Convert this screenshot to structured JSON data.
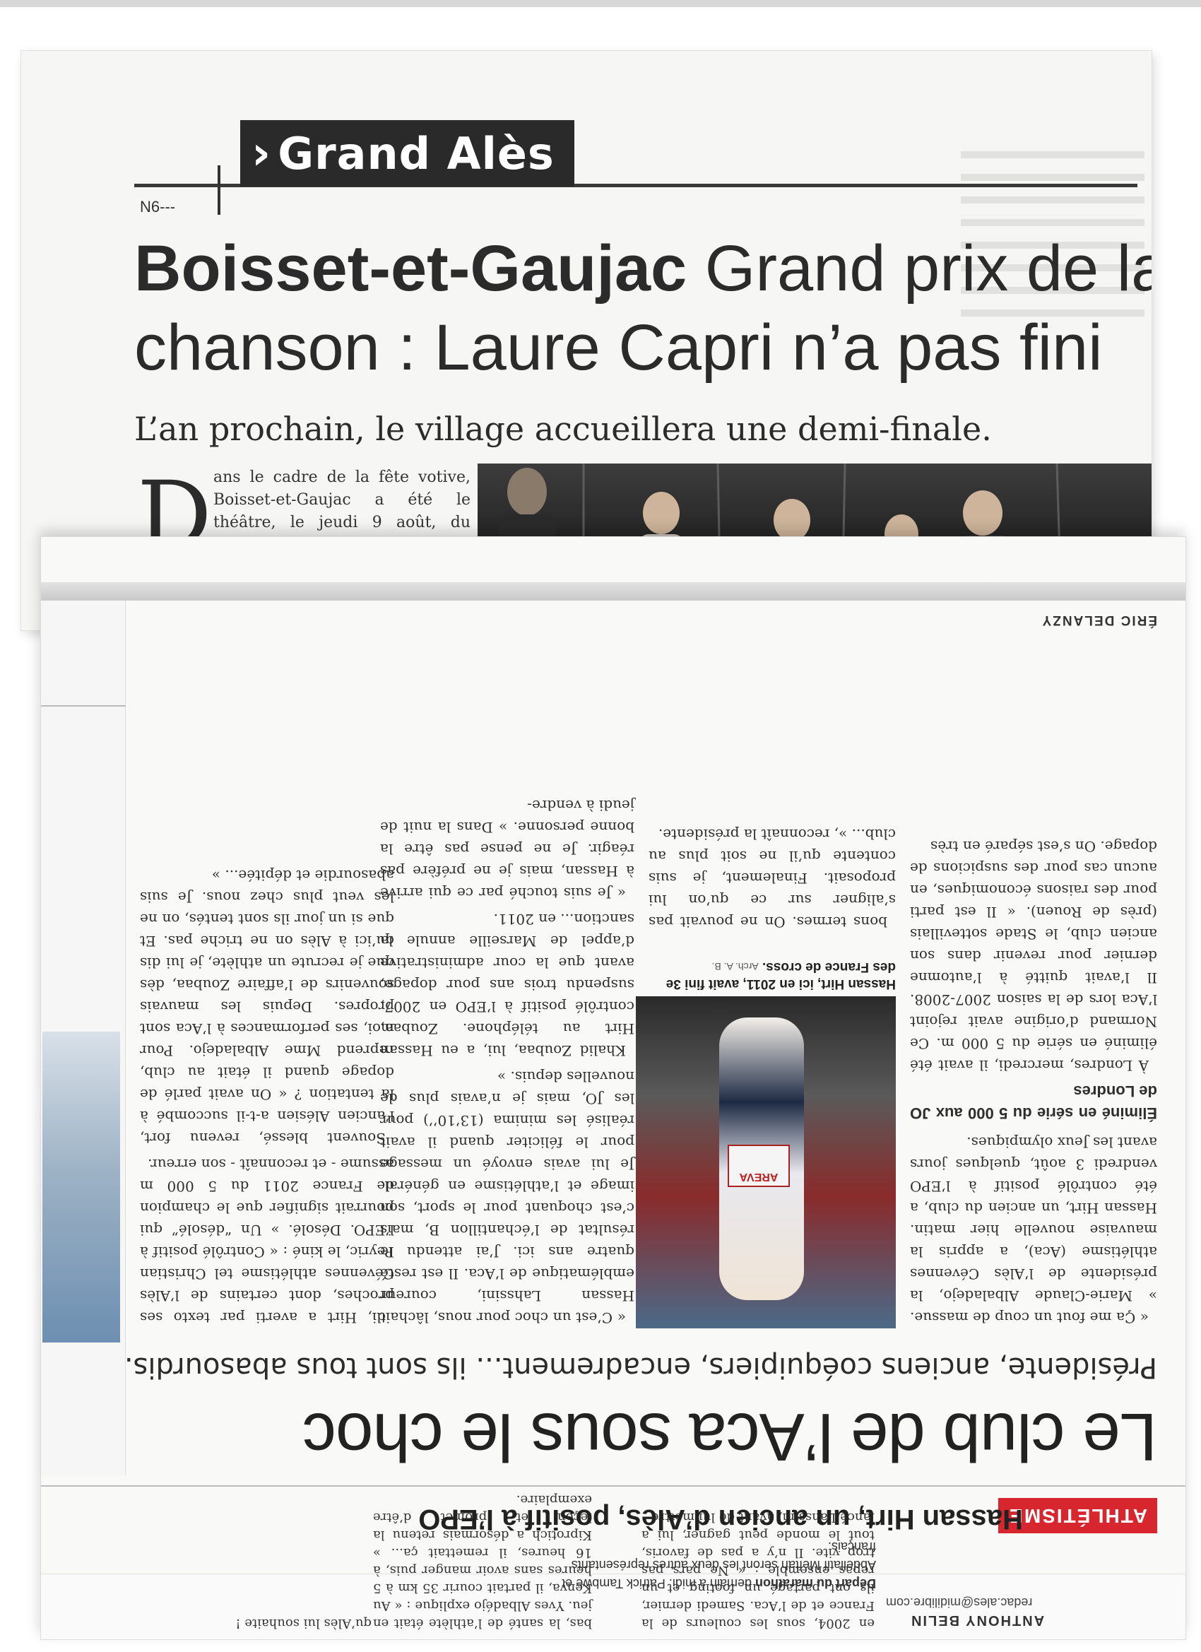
{
  "upper_clipping": {
    "rubric_chevron": "›",
    "rubric": "Grand Alès",
    "page_code": "N6---",
    "headline_place": "Boisset-et-Gaujac",
    "headline_rest": " Grand prix de la",
    "headline_line2": "chanson : Laure Capri n’a pas fini",
    "subhead": "L’an prochain, le village accueillera une demi-finale.",
    "dropcap": "D",
    "intro": "ans le cadre de la fête votive, Boisset-et-Gaujac a été le théâtre, le jeudi 9 août, du quart de finale du grand prix de la chan-"
  },
  "lower_clipping": {
    "byline_top": "ANTHONY BELIN",
    "email": "redac.ales@midilibre.com",
    "brief_title": "Départ du marathon",
    "brief_text": " demain à midi. Patrick Tambwe et Abdellatif Meftah seront les deux autres représentants français.",
    "mini_col_a": "bas, la santé de l’athlète était en jeu. Yves Albadéjo explique : « Au Kenya, il partait courir 35 km à 5 heures sans avoir manger puis, à 16 heures, il remettait ça... » Kiprotich a désormais retenu la leçon et promet d’être exemplaire.",
    "mini_col_b": "en 2004, sous les couleurs de la France et de l’Aca. Samedi dernier, ils ont partagé un footing et un repas ensemble : « Ne pars pas trop vite. Il n’y a pas de favoris, tout le monde peut gagner, lui a lancé Lahssini, avant de lui mettre",
    "mini_col_c": "qu’Alès lui souhaite !",
    "tag": "ATHLÉTISME",
    "kicker": "Hassan Hirt, un ancien d’Alès, positif à l’EPO",
    "headline": "Le club de l’Aca sous le choc",
    "deck": "Présidente, anciens coéquipiers, encadrement... ils sont tous abasourdis.",
    "col1": [
      "« Ça me fout un coup de massue. » Marie-Claude Albaladejo, la présidente de l’Alès Cévennes athlétisme (Aca), a appris la mauvaise nouvelle hier matin. Hassan Hirt, un ancien du club, a été contrôlé positif à l’EPO vendredi 3 août, quelques jours avant les Jeux olympiques."
    ],
    "col1_sub": "Éliminé en série du 5 000 aux JO de Londres",
    "col1_b": "À Londres, mercredi, il avait été éliminé en série du 5 000 m. Ce Normand d’origine avait rejoint l’Aca lors de la saison 2007-2008. Il l’avait quitté à l’automne dernier pour revenir dans son ancien club, le Stade sottevillais (près de Rouen). « Il est parti pour des raisons économiques, en aucun cas pour des suspicions de dopage. On s’est séparé en très",
    "col2": "bons termes. On ne pouvait pas s’aligner sur ce qu’on lui proposait. Finalement, je suis contente qu’il ne soit plus au club... », reconnaît la présidente.",
    "col3": [
      "« C’est un choc pour nous, lâchait Hassan Lahssini, coureur emblématique de l’Aca. Il est resté quatre ans ici. J’ai attendu le résultat de l’échantillon B, mais c’est choquant pour le sport, son image et l’athlétisme en général. Je lui avais envoyé un message pour le féliciter quand il avait réalisé les minima (13’10’’) pour les JO, mais je n’avais plus de nouvelles depuis. »",
      "Khalid Zoubaa, lui, a eu Hassan Hirt au téléphone. Zoubaa, contrôlé positif à l’EPO en 2007, suspendu trois ans pour dopage, avant que la cour administrative d’appel de Marseille annule la sanction... en 2011.",
      "« Je suis touché par ce qui arrive à Hassan, mais je ne préfère pas réagir. Je ne pense pas être la bonne personne. » Dans la nuit de jeudi à vendre-"
    ],
    "col4": [
      "di, Hirt a averti par texto ses proches, dont certains de l’Alès Cévennes athlétisme tel Christian Peyric, le kiné : « Contrôlé positif à l’EPO. Désolé. » Un “désolé” qui pourrait signifier que le champion de France 2011 du 5 000 m assume - et reconnaît - son erreur.",
      "Souvent blessé, revenu fort, l’ancien Alésien a-t-il succombé à la tentation ? « On avait parlé de dopage quand il était au club, reprend Mme Albaladejo. Pour moi, ses performances à l’Aca sont propres. Depuis les mauvais souvenirs de l’affaire Zoubaa, dès que je recrute un athlète, je lui dis qu’ici à Alès on ne triche pas. Et que si un jour ils sont tentés, on ne les veut plus chez nous. Je suis abasourdie et dépitée... »"
    ],
    "photo_bib_sponsor": "AREVA",
    "caption_bold": "Hassan Hirt, ici en 2011, avait fini 3e des France de cross.",
    "caption_credit": "Arch. A. B.",
    "signature": "ÉRIC DELANZY"
  }
}
